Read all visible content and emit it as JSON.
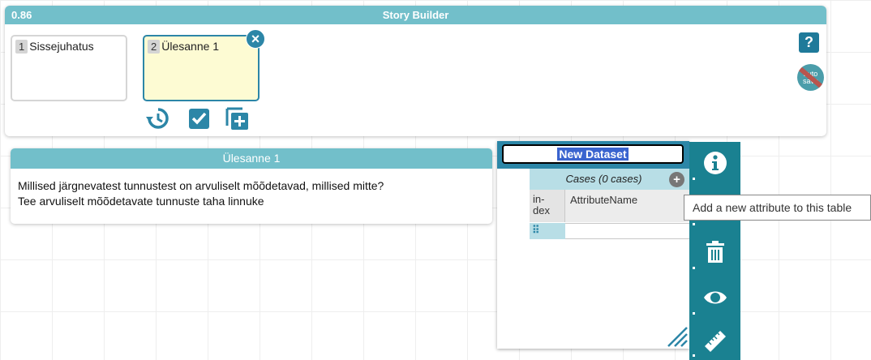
{
  "story_builder": {
    "version": "0.86",
    "title": "Story Builder",
    "slides": [
      {
        "number": "1",
        "label": "Sissejuhatus"
      },
      {
        "number": "2",
        "label": "Ülesanne 1"
      }
    ],
    "help_label": "?",
    "autosave_label": "auto save"
  },
  "text_tile": {
    "title": "Ülesanne 1",
    "line1": "Millised järgnevatest tunnustest on arvuliselt mõõdetavad, millised mitte?",
    "line2": "Tee arvuliselt mõõdetavate tunnuste taha linnuke"
  },
  "table_tile": {
    "dataset_name": "New Dataset",
    "cases_label": "Cases (0 cases)",
    "index_header": "in-\ndex",
    "attribute_header": "AttributeName"
  },
  "tooltip": "Add a new attribute to this table",
  "colors": {
    "header_teal": "#72bfca",
    "accent_blue": "#2c86a7",
    "toolbar_teal": "#1a8191",
    "active_slide_bg": "#fdfbd3"
  }
}
